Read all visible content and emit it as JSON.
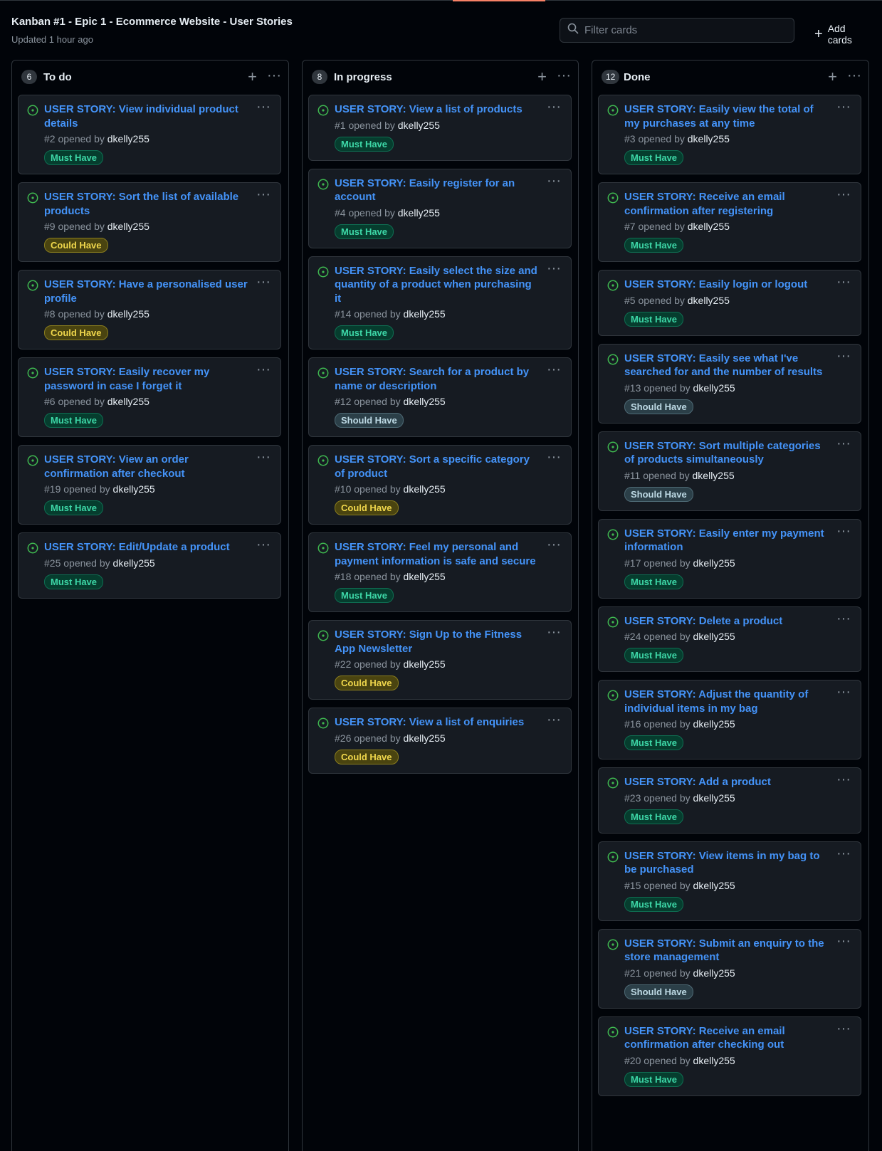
{
  "board": {
    "title": "Kanban #1 - Epic 1 - Ecommerce Website - User Stories",
    "updated": "Updated 1 hour ago",
    "filter_placeholder": "Filter cards",
    "add_cards_label": "Add cards"
  },
  "labels": {
    "must": "Must Have",
    "could": "Could Have",
    "should": "Should Have"
  },
  "colors": {
    "background": "#010409",
    "card": "#161b22",
    "link": "#4493f8",
    "open_icon": "#3fb950",
    "accent": "#f78166"
  },
  "columns": [
    {
      "name": "To do",
      "count": "6",
      "cards": [
        {
          "title": "USER STORY: View individual product details",
          "number": "#2",
          "opened_by": "opened by",
          "author": "dkelly255",
          "label": "Must Have",
          "label_kind": "must"
        },
        {
          "title": "USER STORY: Sort the list of available products",
          "number": "#9",
          "opened_by": "opened by",
          "author": "dkelly255",
          "label": "Could Have",
          "label_kind": "could"
        },
        {
          "title": "USER STORY: Have a personalised user profile",
          "number": "#8",
          "opened_by": "opened by",
          "author": "dkelly255",
          "label": "Could Have",
          "label_kind": "could"
        },
        {
          "title": "USER STORY: Easily recover my password in case I forget it",
          "number": "#6",
          "opened_by": "opened by",
          "author": "dkelly255",
          "label": "Must Have",
          "label_kind": "must"
        },
        {
          "title": "USER STORY: View an order confirmation after checkout",
          "number": "#19",
          "opened_by": "opened by",
          "author": "dkelly255",
          "label": "Must Have",
          "label_kind": "must"
        },
        {
          "title": "USER STORY: Edit/Update a product",
          "number": "#25",
          "opened_by": "opened by",
          "author": "dkelly255",
          "label": "Must Have",
          "label_kind": "must"
        }
      ]
    },
    {
      "name": "In progress",
      "count": "8",
      "cards": [
        {
          "title": "USER STORY: View a list of products",
          "number": "#1",
          "opened_by": "opened by",
          "author": "dkelly255",
          "label": "Must Have",
          "label_kind": "must"
        },
        {
          "title": "USER STORY: Easily register for an account",
          "number": "#4",
          "opened_by": "opened by",
          "author": "dkelly255",
          "label": "Must Have",
          "label_kind": "must"
        },
        {
          "title": "USER STORY: Easily select the size and quantity of a product when purchasing it",
          "number": "#14",
          "opened_by": "opened by",
          "author": "dkelly255",
          "label": "Must Have",
          "label_kind": "must"
        },
        {
          "title": "USER STORY: Search for a product by name or description",
          "number": "#12",
          "opened_by": "opened by",
          "author": "dkelly255",
          "label": "Should Have",
          "label_kind": "should"
        },
        {
          "title": "USER STORY: Sort a specific category of product",
          "number": "#10",
          "opened_by": "opened by",
          "author": "dkelly255",
          "label": "Could Have",
          "label_kind": "could"
        },
        {
          "title": "USER STORY: Feel my personal and payment information is safe and secure",
          "number": "#18",
          "opened_by": "opened by",
          "author": "dkelly255",
          "label": "Must Have",
          "label_kind": "must"
        },
        {
          "title": "USER STORY: Sign Up to the Fitness App Newsletter",
          "number": "#22",
          "opened_by": "opened by",
          "author": "dkelly255",
          "label": "Could Have",
          "label_kind": "could"
        },
        {
          "title": "USER STORY: View a list of enquiries",
          "number": "#26",
          "opened_by": "opened by",
          "author": "dkelly255",
          "label": "Could Have",
          "label_kind": "could"
        }
      ]
    },
    {
      "name": "Done",
      "count": "12",
      "cards": [
        {
          "title": "USER STORY: Easily view the total of my purchases at any time",
          "number": "#3",
          "opened_by": "opened by",
          "author": "dkelly255",
          "label": "Must Have",
          "label_kind": "must"
        },
        {
          "title": "USER STORY: Receive an email confirmation after registering",
          "number": "#7",
          "opened_by": "opened by",
          "author": "dkelly255",
          "label": "Must Have",
          "label_kind": "must"
        },
        {
          "title": "USER STORY: Easily login or logout",
          "number": "#5",
          "opened_by": "opened by",
          "author": "dkelly255",
          "label": "Must Have",
          "label_kind": "must"
        },
        {
          "title": "USER STORY: Easily see what I've searched for and the number of results",
          "number": "#13",
          "opened_by": "opened by",
          "author": "dkelly255",
          "label": "Should Have",
          "label_kind": "should"
        },
        {
          "title": "USER STORY: Sort multiple categories of products simultaneously",
          "number": "#11",
          "opened_by": "opened by",
          "author": "dkelly255",
          "label": "Should Have",
          "label_kind": "should"
        },
        {
          "title": "USER STORY: Easily enter my payment information",
          "number": "#17",
          "opened_by": "opened by",
          "author": "dkelly255",
          "label": "Must Have",
          "label_kind": "must"
        },
        {
          "title": "USER STORY: Delete a product",
          "number": "#24",
          "opened_by": "opened by",
          "author": "dkelly255",
          "label": "Must Have",
          "label_kind": "must"
        },
        {
          "title": "USER STORY: Adjust the quantity of individual items in my bag",
          "number": "#16",
          "opened_by": "opened by",
          "author": "dkelly255",
          "label": "Must Have",
          "label_kind": "must"
        },
        {
          "title": "USER STORY: Add a product",
          "number": "#23",
          "opened_by": "opened by",
          "author": "dkelly255",
          "label": "Must Have",
          "label_kind": "must"
        },
        {
          "title": "USER STORY: View items in my bag to be purchased",
          "number": "#15",
          "opened_by": "opened by",
          "author": "dkelly255",
          "label": "Must Have",
          "label_kind": "must"
        },
        {
          "title": "USER STORY: Submit an enquiry to the store management",
          "number": "#21",
          "opened_by": "opened by",
          "author": "dkelly255",
          "label": "Should Have",
          "label_kind": "should"
        },
        {
          "title": "USER STORY: Receive an email confirmation after checking out",
          "number": "#20",
          "opened_by": "opened by",
          "author": "dkelly255",
          "label": "Must Have",
          "label_kind": "must"
        }
      ]
    }
  ]
}
